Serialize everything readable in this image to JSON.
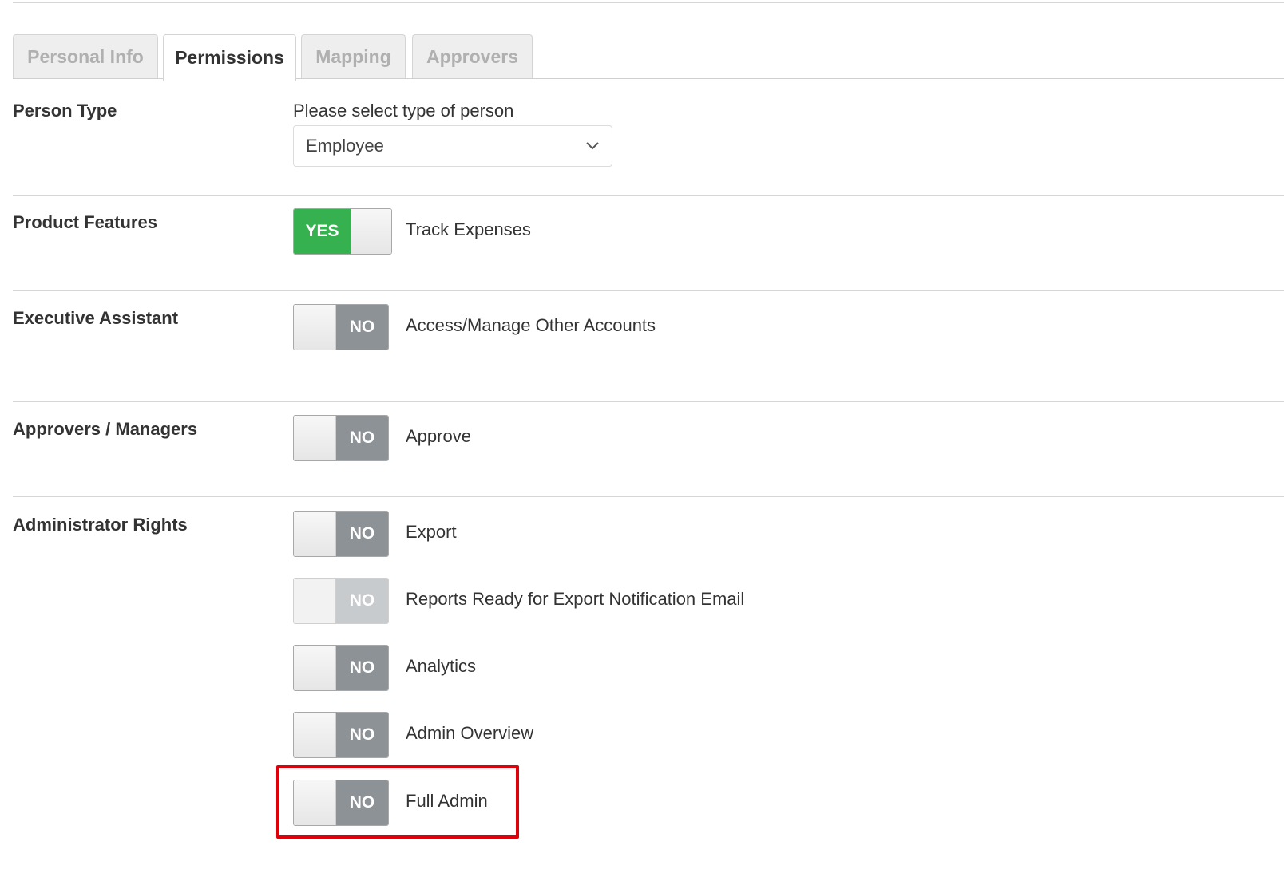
{
  "tabs": [
    {
      "label": "Personal Info",
      "active": false
    },
    {
      "label": "Permissions",
      "active": true
    },
    {
      "label": "Mapping",
      "active": false
    },
    {
      "label": "Approvers",
      "active": false
    }
  ],
  "person_type": {
    "label": "Person Type",
    "caption": "Please select type of person",
    "selected": "Employee"
  },
  "product_features": {
    "label": "Product Features",
    "toggles": [
      {
        "state": "YES",
        "label": "Track Expenses"
      }
    ]
  },
  "executive_assistant": {
    "label": "Executive Assistant",
    "toggles": [
      {
        "state": "NO",
        "label": "Access/Manage Other Accounts"
      }
    ]
  },
  "approvers_managers": {
    "label": "Approvers / Managers",
    "toggles": [
      {
        "state": "NO",
        "label": "Approve"
      }
    ]
  },
  "administrator_rights": {
    "label": "Administrator Rights",
    "toggles": [
      {
        "state": "NO",
        "label": "Export",
        "disabled": false
      },
      {
        "state": "NO",
        "label": "Reports Ready for Export Notification Email",
        "disabled": true
      },
      {
        "state": "NO",
        "label": "Analytics",
        "disabled": false
      },
      {
        "state": "NO",
        "label": "Admin Overview",
        "disabled": false
      },
      {
        "state": "NO",
        "label": "Full Admin",
        "disabled": false,
        "highlighted": true
      }
    ]
  },
  "colors": {
    "yes_green": "#35b24f",
    "no_gray": "#8d9297",
    "highlight_red": "#e0000a"
  }
}
